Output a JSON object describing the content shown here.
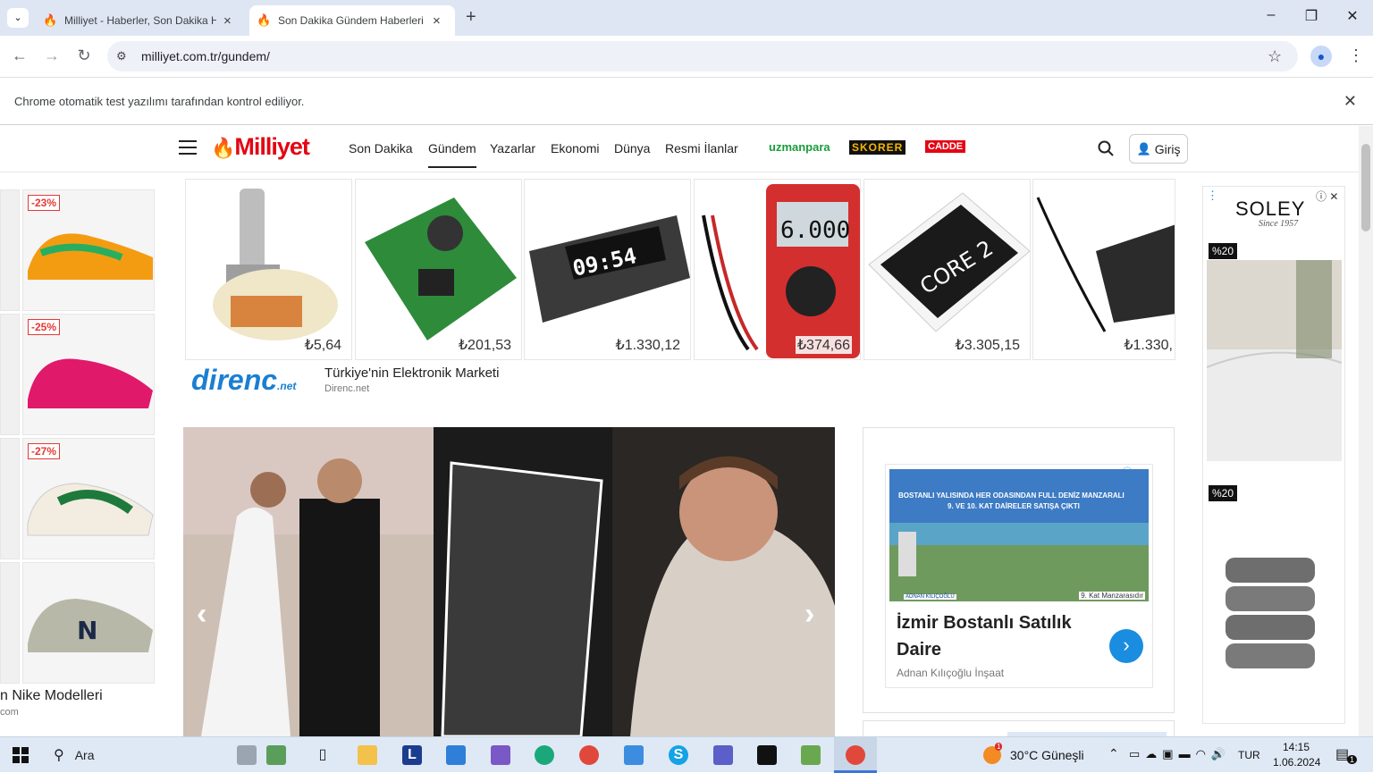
{
  "browser": {
    "tabs": [
      {
        "title": "Milliyet - Haberler, Son Dakika Haberler"
      },
      {
        "title": "Son Dakika Gündem Haberleri"
      }
    ],
    "new_tab": "+",
    "url": "milliyet.com.tr/gundem/",
    "infobar": "Chrome otomatik test yazılımı tarafından kontrol ediliyor."
  },
  "header": {
    "logo": "Milliyet",
    "nav": [
      "Son Dakika",
      "Gündem",
      "Yazarlar",
      "Ekonomi",
      "Dünya",
      "Resmi İlanlar"
    ],
    "partners": [
      "uzmanpara",
      "SKORER",
      "CADDE"
    ],
    "login": "Giriş"
  },
  "product_ad": {
    "prices": [
      "₺5,64",
      "₺201,53",
      "₺1.330,12",
      "₺374,66",
      "₺3.305,15",
      "₺1.330,"
    ],
    "display_texts": [
      "09:54",
      "6.000",
      "CORE 2"
    ],
    "brand": "direnc",
    "brand_suffix": ".net",
    "tagline": "Türkiye'nin Elektronik Marketi",
    "source": "Direnc.net"
  },
  "shoe_ad": {
    "discounts": [
      "-23%",
      "-25%",
      "-27%"
    ],
    "caption": "n Nike Modelleri",
    "source": "com"
  },
  "hero": {
    "prev": "‹",
    "next": "›"
  },
  "right_ad": {
    "banner_line1": "BOSTANLI YALISINDA HER ODASINDAN FULL DENİZ MANZARALI",
    "banner_line2": "9. VE 10. KAT DAİRELER SATIŞA ÇIKTI",
    "banner_foot": "9. Kat Manzarasıdır",
    "banner_brand": "ADNAN KILIÇOĞLU",
    "title": "İzmir Bostanlı Satılık Daire",
    "source": "Adnan Kılıçoğlu İnşaat"
  },
  "soley_ad": {
    "brand": "SOLEY",
    "since": "Since 1957",
    "badges": [
      "%20",
      "%20"
    ]
  },
  "taskbar": {
    "search": "Ara",
    "weather": "30°C Güneşli",
    "weather_badge": "1",
    "lang": "TUR",
    "time": "14:15",
    "date": "1.06.2024",
    "notif_count": "1"
  },
  "colors": {
    "brand": "#e30613",
    "tab_bg": "#dfe6f3",
    "taskbar": "#dfe9f5"
  }
}
